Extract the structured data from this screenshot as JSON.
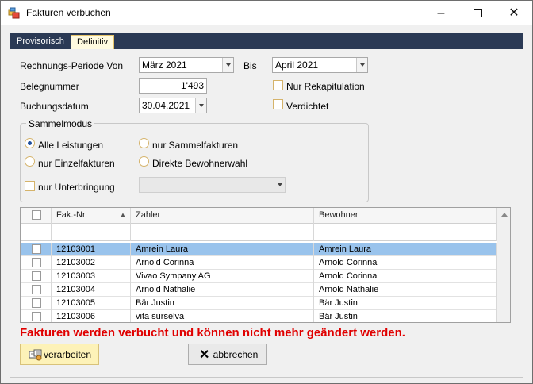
{
  "window": {
    "title": "Fakturen verbuchen",
    "app_icon": "app-icon",
    "minimize_icon": "minimize-icon",
    "maximize_icon": "maximize-icon",
    "close_icon": "close-icon"
  },
  "tabs": [
    {
      "label": "Provisorisch",
      "active": false
    },
    {
      "label": "Definitiv",
      "active": true
    }
  ],
  "form": {
    "periode_label": "Rechnungs-Periode Von",
    "periode_von": "März 2021",
    "bis_label": "Bis",
    "periode_bis": "April 2021",
    "belegnummer_label": "Belegnummer",
    "belegnummer_value": "1'493",
    "buchungsdatum_label": "Buchungsdatum",
    "buchungsdatum_value": "30.04.2021",
    "nur_rekapitulation_label": "Nur Rekapitulation",
    "nur_rekapitulation_checked": false,
    "verdichtet_label": "Verdichtet",
    "verdichtet_checked": false
  },
  "sammelmodus": {
    "title": "Sammelmodus",
    "options": [
      {
        "label": "Alle Leistungen",
        "selected": true
      },
      {
        "label": "nur Sammelfakturen",
        "selected": false
      },
      {
        "label": "nur Einzelfakturen",
        "selected": false
      },
      {
        "label": "Direkte Bewohnerwahl",
        "selected": false
      }
    ],
    "unterbringung_label": "nur Unterbringung",
    "unterbringung_checked": false,
    "unterbringung_value": ""
  },
  "grid": {
    "columns": [
      "",
      "Fak.-Nr.",
      "Zahler",
      "Bewohner"
    ],
    "sort_icon": "sort-ascending-icon",
    "rows": [
      {
        "fak_nr": "12103001",
        "zahler": "Amrein Laura",
        "bewohner": "Amrein Laura",
        "selected": true
      },
      {
        "fak_nr": "12103002",
        "zahler": "Arnold Corinna",
        "bewohner": "Arnold Corinna",
        "selected": false
      },
      {
        "fak_nr": "12103003",
        "zahler": "Vivao Sympany AG",
        "bewohner": "Arnold Corinna",
        "selected": false
      },
      {
        "fak_nr": "12103004",
        "zahler": "Arnold Nathalie",
        "bewohner": "Arnold Nathalie",
        "selected": false
      },
      {
        "fak_nr": "12103005",
        "zahler": "Bär Justin",
        "bewohner": "Bär Justin",
        "selected": false
      },
      {
        "fak_nr": "12103006",
        "zahler": "vita surselva",
        "bewohner": "Bär Justin",
        "selected": false
      }
    ]
  },
  "warning": "Fakturen werden verbucht und können nicht mehr geändert werden.",
  "buttons": {
    "verarbeiten": "verarbeiten",
    "verarbeiten_icon": "process-icon",
    "abbrechen": "abbrechen",
    "abbrechen_icon": "cancel-x-icon"
  },
  "colors": {
    "tab_bar": "#2b3a55",
    "selected_row": "#99c3ec",
    "warning": "#e00000",
    "primary_button": "#fdf2b8"
  }
}
